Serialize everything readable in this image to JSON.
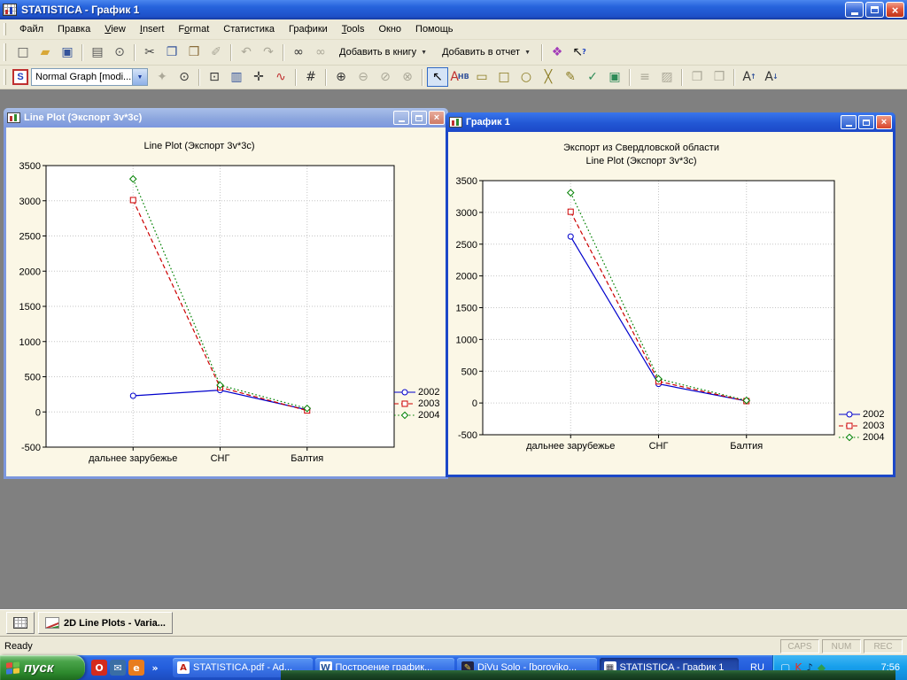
{
  "app": {
    "title": "STATISTICA - График 1"
  },
  "menu": {
    "items": [
      {
        "id": "file",
        "label": "Файл"
      },
      {
        "id": "edit",
        "label": "Правка"
      },
      {
        "id": "view",
        "label": "View",
        "u": 0
      },
      {
        "id": "insert",
        "label": "Insert",
        "u": 0
      },
      {
        "id": "format",
        "label": "Format",
        "u": 1
      },
      {
        "id": "statistics",
        "label": "Статистика"
      },
      {
        "id": "graphs",
        "label": "Графики"
      },
      {
        "id": "tools",
        "label": "Tools",
        "u": 0
      },
      {
        "id": "window",
        "label": "Окно"
      },
      {
        "id": "help",
        "label": "Помощь"
      }
    ]
  },
  "toolbar_main": {
    "items": [
      {
        "n": "new-document-icon",
        "g": "□",
        "c": "#555555"
      },
      {
        "n": "open-folder-icon",
        "g": "▰",
        "c": "#D8A838"
      },
      {
        "n": "save-icon",
        "g": "▣",
        "c": "#35549B"
      },
      {
        "sep": 1
      },
      {
        "n": "print-icon",
        "g": "▤",
        "c": "#555555"
      },
      {
        "n": "print-preview-icon",
        "g": "⊙",
        "c": "#555555"
      },
      {
        "sep": 1
      },
      {
        "n": "cut-icon",
        "g": "✂",
        "c": "#444444"
      },
      {
        "n": "copy-icon",
        "g": "❐",
        "c": "#35549B"
      },
      {
        "n": "paste-icon",
        "g": "❒",
        "c": "#8A6D3B"
      },
      {
        "n": "format-painter-icon",
        "g": "✐",
        "c": "#A8A595",
        "d": 1
      },
      {
        "sep": 1
      },
      {
        "n": "undo-icon",
        "g": "↶",
        "c": "#A8A595",
        "d": 1
      },
      {
        "n": "redo-icon",
        "g": "↷",
        "c": "#A8A595",
        "d": 1
      },
      {
        "sep": 1
      },
      {
        "n": "find-icon",
        "g": "∞",
        "c": "#333333"
      },
      {
        "n": "find-replace-icon",
        "g": "∞",
        "c": "#A8A595",
        "d": 1
      },
      {
        "n": "add-to-workbook-button",
        "label": "Добавить в книгу",
        "arrow": 1
      },
      {
        "n": "add-to-report-button",
        "label": "Добавить в отчет",
        "arrow": 1
      },
      {
        "sep": 1
      },
      {
        "n": "help-book-icon",
        "g": "❖",
        "c": "#A23BB8"
      },
      {
        "n": "context-help-icon",
        "g": "↖",
        "c": "#111111",
        "g2": "?",
        "c2": "#1A3FC0"
      }
    ]
  },
  "toolbar_graph": {
    "style_prefix": "S",
    "style_label": "Normal Graph [modi...",
    "items": [
      {
        "n": "apply-style-icon",
        "g": "✦",
        "c": "#A8A595",
        "d": 1
      },
      {
        "n": "zoom-mode-icon",
        "g": "⊙",
        "c": "#333333"
      },
      {
        "sep": 1
      },
      {
        "n": "select-mode-icon",
        "g": "⊡",
        "c": "#333333"
      },
      {
        "n": "graph-options-icon",
        "g": "▥",
        "c": "#35549B"
      },
      {
        "n": "move-resize-icon",
        "g": "✛",
        "c": "#333333"
      },
      {
        "n": "mini-graph-icon",
        "g": "∿",
        "c": "#C03030"
      },
      {
        "sep": 1
      },
      {
        "n": "grid-options-icon",
        "g": "#",
        "c": "#333333"
      },
      {
        "sep": 1
      },
      {
        "n": "zoom-in-icon",
        "g": "⊕",
        "c": "#333333"
      },
      {
        "n": "zoom-out-icon",
        "g": "⊖",
        "c": "#A8A595",
        "d": 1
      },
      {
        "n": "zoom-custom-icon",
        "g": "⊘",
        "c": "#A8A595",
        "d": 1
      },
      {
        "n": "zoom-off-icon",
        "g": "⊗",
        "c": "#A8A595",
        "d": 1
      },
      {
        "sep": 1
      },
      {
        "n": "pointer-tool-icon",
        "g": "↖",
        "c": "#000000",
        "pressed": 1
      },
      {
        "n": "text-tool-icon",
        "g": "A",
        "c": "#C03030",
        "g2": "HB",
        "c2": "#35549B"
      },
      {
        "n": "draw-rect-icon",
        "g": "▭",
        "c": "#8A7A20"
      },
      {
        "n": "draw-round-rect-icon",
        "g": "□",
        "c": "#8A7A20"
      },
      {
        "n": "draw-ellipse-icon",
        "g": "○",
        "c": "#8A7A20"
      },
      {
        "n": "draw-polyline-icon",
        "g": "╳",
        "c": "#8A7A20"
      },
      {
        "n": "draw-freehand-icon",
        "g": "✎",
        "c": "#8A7A20"
      },
      {
        "n": "draw-check-icon",
        "g": "✓",
        "c": "#2E8B57"
      },
      {
        "n": "screen-catcher-icon",
        "g": "▣",
        "c": "#2E8B57"
      },
      {
        "sep": 1
      },
      {
        "n": "line-style-icon",
        "g": "≡",
        "c": "#A8A595",
        "d": 1
      },
      {
        "n": "fill-pattern-icon",
        "g": "▨",
        "c": "#A8A595",
        "d": 1
      },
      {
        "sep": 1
      },
      {
        "n": "bring-front-icon",
        "g": "❐",
        "c": "#A8A595",
        "d": 1
      },
      {
        "n": "send-back-icon",
        "g": "❒",
        "c": "#A8A595",
        "d": 1
      },
      {
        "sep": 1
      },
      {
        "n": "font-increase-icon",
        "g": "A",
        "c": "#333333",
        "g2": "↑",
        "c2": "#35549B"
      },
      {
        "n": "font-decrease-icon",
        "g": "A",
        "c": "#333333",
        "g2": "↓",
        "c2": "#35549B"
      }
    ]
  },
  "windows": [
    {
      "title": "Line Plot (Экспорт 3v*3c)",
      "active": false
    },
    {
      "title": "График 1",
      "active": true
    }
  ],
  "chart_data": [
    {
      "type": "line",
      "titles": [
        "Line Plot (Экспорт 3v*3c)"
      ],
      "categories": [
        "дальнее зарубежье",
        "СНГ",
        "Балтия"
      ],
      "ylim": [
        -500,
        3500
      ],
      "ytick_step": 500,
      "grid": true,
      "legend_position": "right",
      "series": [
        {
          "name": "2002",
          "color": "#0000CC",
          "dash": "solid",
          "marker": "circle",
          "values": [
            230,
            310,
            30
          ]
        },
        {
          "name": "2003",
          "color": "#CC0000",
          "dash": "dashed",
          "marker": "square",
          "values": [
            3010,
            350,
            20
          ]
        },
        {
          "name": "2004",
          "color": "#008000",
          "dash": "dotted",
          "marker": "diamond",
          "values": [
            3310,
            380,
            50
          ]
        }
      ]
    },
    {
      "type": "line",
      "titles": [
        "Экспорт из Свердловской области",
        "Line Plot (Экспорт 3v*3c)"
      ],
      "categories": [
        "дальнее зарубежье",
        "СНГ",
        "Балтия"
      ],
      "ylim": [
        -500,
        3500
      ],
      "ytick_step": 500,
      "grid": true,
      "legend_position": "right",
      "series": [
        {
          "name": "2002",
          "color": "#0000CC",
          "dash": "solid",
          "marker": "circle",
          "values": [
            2620,
            300,
            30
          ]
        },
        {
          "name": "2003",
          "color": "#CC0000",
          "dash": "dashed",
          "marker": "square",
          "values": [
            3010,
            340,
            30
          ]
        },
        {
          "name": "2004",
          "color": "#008000",
          "dash": "dotted",
          "marker": "diamond",
          "values": [
            3310,
            380,
            40
          ]
        }
      ]
    }
  ],
  "mdi_bar": {
    "buttons": [
      {
        "n": "statistica-window-button",
        "icon": "statistica-mini-icon",
        "label": ""
      },
      {
        "n": "line-plots-window-button",
        "icon": "line-chart-icon",
        "label": "2D Line Plots - Varia..."
      }
    ]
  },
  "status_bar": {
    "ready": "Ready",
    "indicators": [
      "CAPS",
      "NUM",
      "REC"
    ]
  },
  "taskbar": {
    "start_label": "пуск",
    "quick_launch": [
      {
        "n": "opera-icon",
        "g": "O",
        "bg": "#D42B1E",
        "c": "#FFFFFF"
      },
      {
        "n": "mail-icon",
        "g": "✉",
        "bg": "#3A6EA5",
        "c": "#FFFFFF"
      },
      {
        "n": "firefox-icon",
        "g": "e",
        "bg": "#E87C1E",
        "c": "#FFFFFF"
      },
      {
        "n": "more-toolbars-icon",
        "g": "»",
        "bg": "transparent",
        "c": "#FFFFFF"
      }
    ],
    "buttons": [
      {
        "n": "taskbar-button-pdf",
        "label": "STATISTICA.pdf - Ad...",
        "icon": {
          "n": "pdf-icon",
          "g": "A",
          "c": "#C11E0F",
          "bg": "#FFFFFF"
        }
      },
      {
        "n": "taskbar-button-word",
        "label": "Построение график...",
        "icon": {
          "n": "word-icon",
          "g": "W",
          "c": "#2B579A",
          "bg": "#FFFFFF"
        }
      },
      {
        "n": "taskbar-button-djvu",
        "label": "DjVu Solo - [boroviko...",
        "icon": {
          "n": "djvu-icon",
          "g": "✎",
          "c": "#E8C83C",
          "bg": "#222244"
        }
      },
      {
        "n": "taskbar-button-statistica",
        "label": "STATISTICA - График 1",
        "icon": {
          "n": "statistica-icon",
          "g": "▦",
          "c": "#333344",
          "bg": "#FFFFFF"
        },
        "active": true
      }
    ],
    "language": "RU",
    "tray_icons": [
      {
        "n": "display-icon",
        "g": "▢",
        "c": "#D6E8F8"
      },
      {
        "n": "kaspersky-icon",
        "g": "K",
        "c": "#E43022"
      },
      {
        "n": "volume-icon",
        "g": "♪",
        "c": "#102040"
      },
      {
        "n": "updater-icon",
        "g": "◆",
        "c": "#2E9A4E"
      }
    ],
    "time": "7:56"
  }
}
